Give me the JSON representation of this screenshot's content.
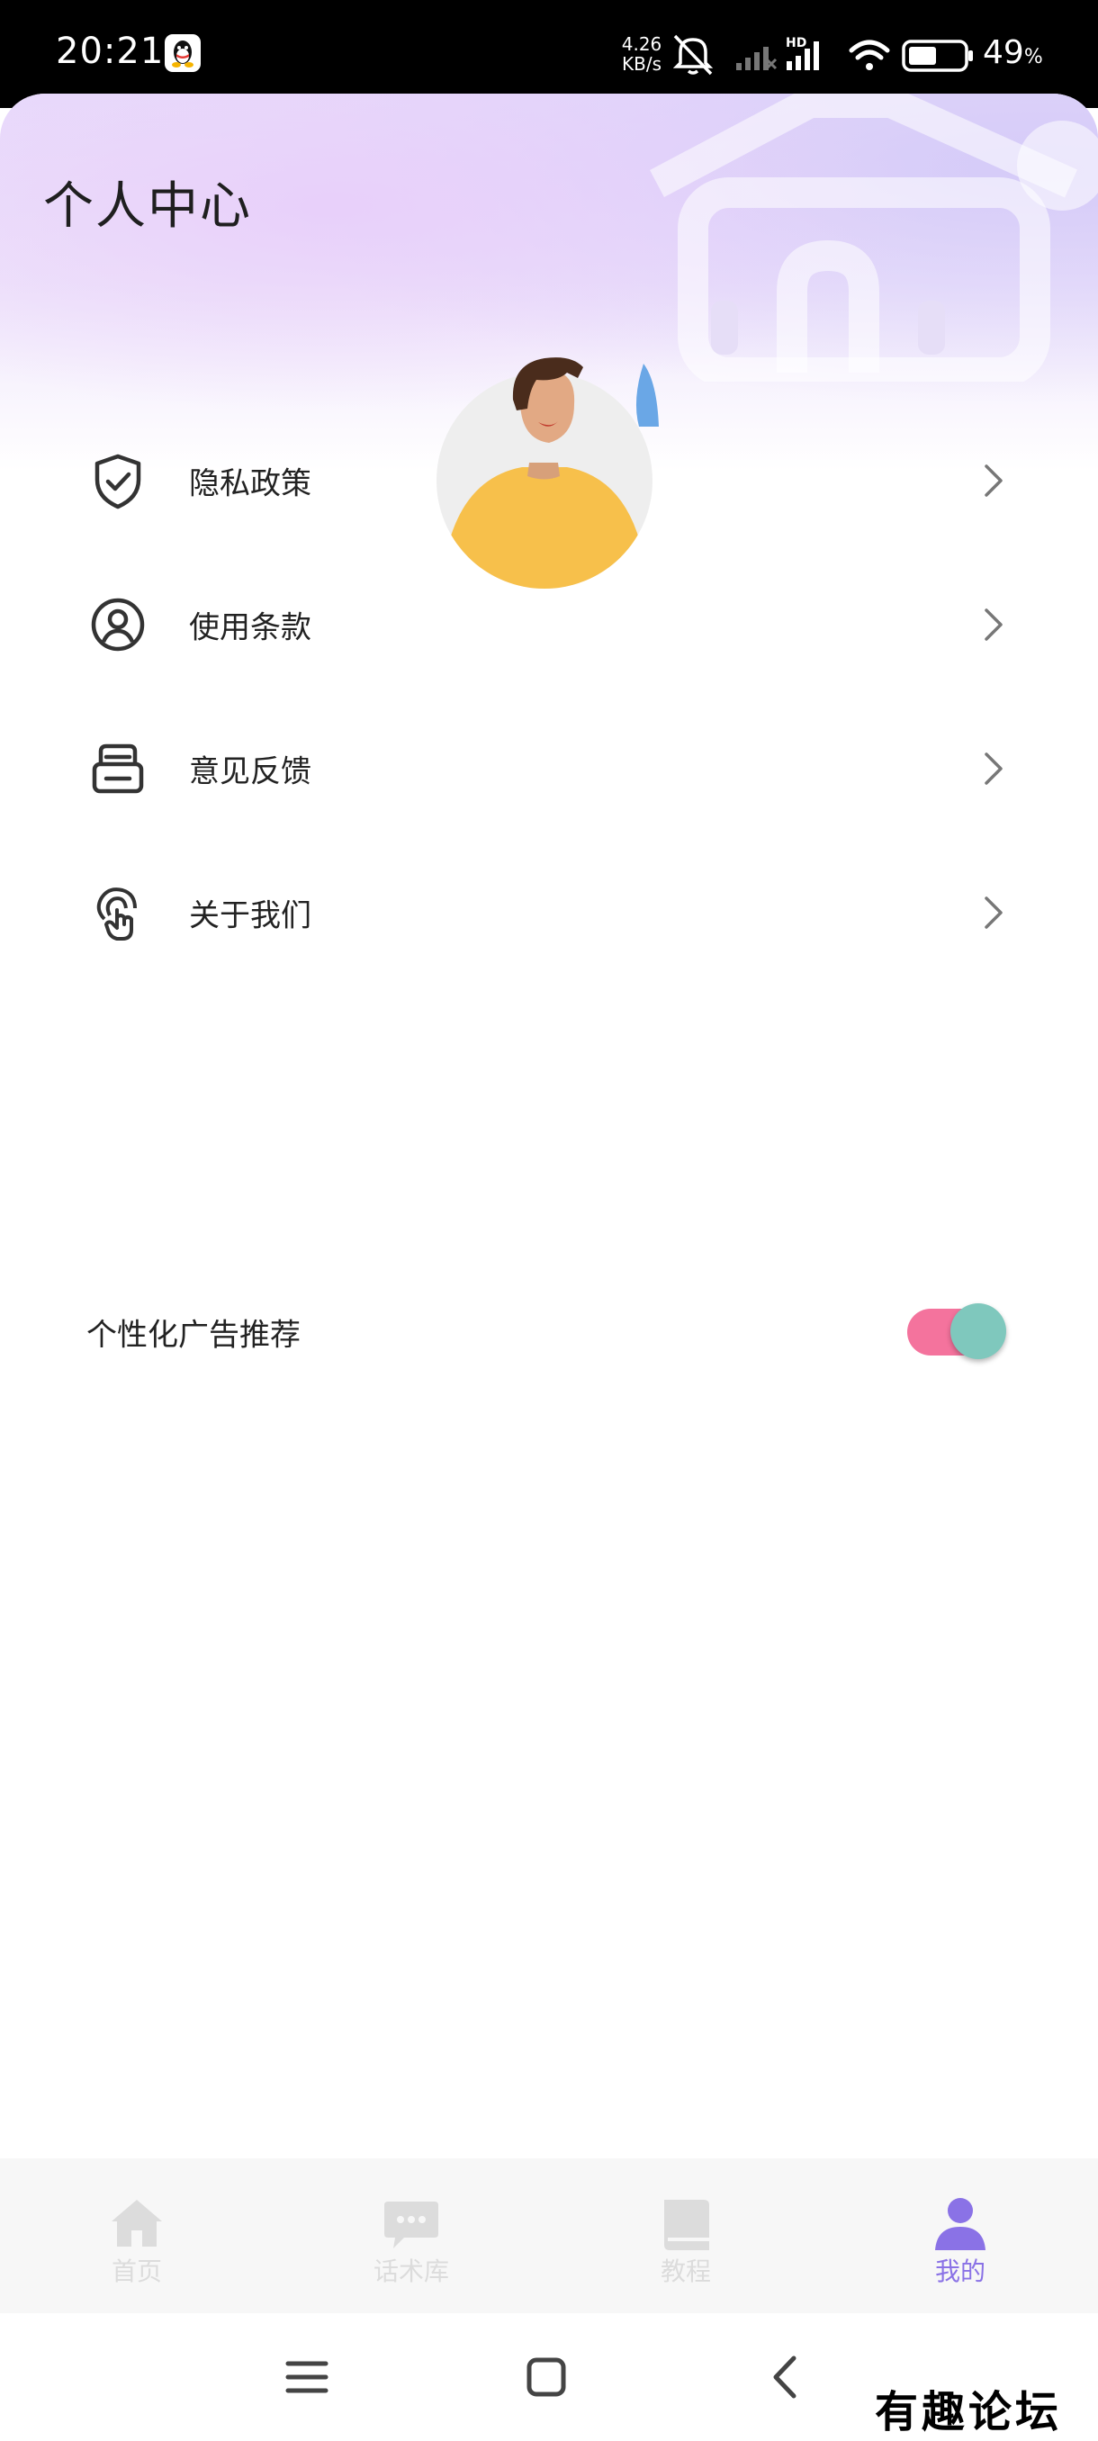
{
  "status_bar": {
    "time": "20:21",
    "net_speed_value": "4.26",
    "net_speed_unit": "KB/s",
    "hd_label": "HD",
    "battery_percent": "49",
    "battery_unit": "%",
    "icons": [
      "qq-icon",
      "mute-icon",
      "signal-icon",
      "hd-signal-icon",
      "wifi-icon",
      "battery-icon"
    ]
  },
  "header": {
    "title": "个人中心"
  },
  "menu": {
    "items": [
      {
        "label": "隐私政策",
        "icon": "shield-check-icon"
      },
      {
        "label": "使用条款",
        "icon": "user-circle-icon"
      },
      {
        "label": "意见反馈",
        "icon": "inbox-tray-icon"
      },
      {
        "label": "关于我们",
        "icon": "touch-hand-icon"
      }
    ],
    "toggle": {
      "label": "个性化广告推荐",
      "enabled": true
    }
  },
  "tabbar": {
    "tabs": [
      {
        "label": "首页",
        "icon": "home-icon",
        "active": false
      },
      {
        "label": "话术库",
        "icon": "chat-bubble-icon",
        "active": false
      },
      {
        "label": "教程",
        "icon": "book-icon",
        "active": false
      },
      {
        "label": "我的",
        "icon": "person-icon",
        "active": true
      }
    ]
  },
  "colors": {
    "accent": "#8a72e6",
    "toggle_track": "#f4739d",
    "toggle_knob": "#7fc8bd",
    "tab_inactive": "#dcdcdc"
  },
  "watermark": "有趣论坛"
}
